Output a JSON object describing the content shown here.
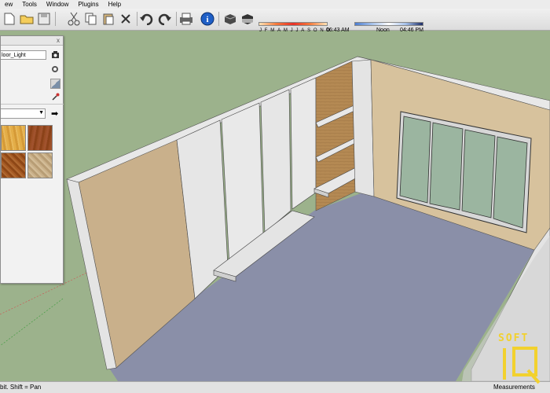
{
  "menu": {
    "items": [
      {
        "id": "view",
        "label": "ew"
      },
      {
        "id": "tools",
        "label": "Tools"
      },
      {
        "id": "window",
        "label": "Window"
      },
      {
        "id": "plugins",
        "label": "Plugins"
      },
      {
        "id": "help",
        "label": "Help"
      }
    ]
  },
  "toolbar": {
    "icons": [
      "new-file-icon",
      "open-file-icon",
      "cut-icon",
      "copy-icon",
      "paste-icon",
      "erase-icon",
      "undo-icon",
      "redo-icon",
      "print-icon",
      "model-info-icon",
      "shadows-icon",
      "fog-icon"
    ]
  },
  "shadows": {
    "months": [
      "J",
      "F",
      "M",
      "A",
      "M",
      "J",
      "J",
      "A",
      "S",
      "O",
      "N",
      "D"
    ],
    "time_start": "06:43 AM",
    "time_mid": "Noon",
    "time_end": "04:46 PM"
  },
  "materials": {
    "close_label": "x",
    "material_name": "loor_Light",
    "library_selected": ""
  },
  "status": {
    "text": "bit.  Shift = Pan",
    "measurements_label": "Measurements"
  },
  "watermark": {
    "top_text": "SOFT",
    "bottom_text": "IQ"
  },
  "colors": {
    "sky": "#9cb28c",
    "floor": "#8a8fa8",
    "wall_left": "#c9b08b",
    "wall_back": "#d7c29d",
    "wood_panel": "#b48953",
    "door_panel": "#e4e4e4",
    "watermark": "#f2d12e"
  }
}
